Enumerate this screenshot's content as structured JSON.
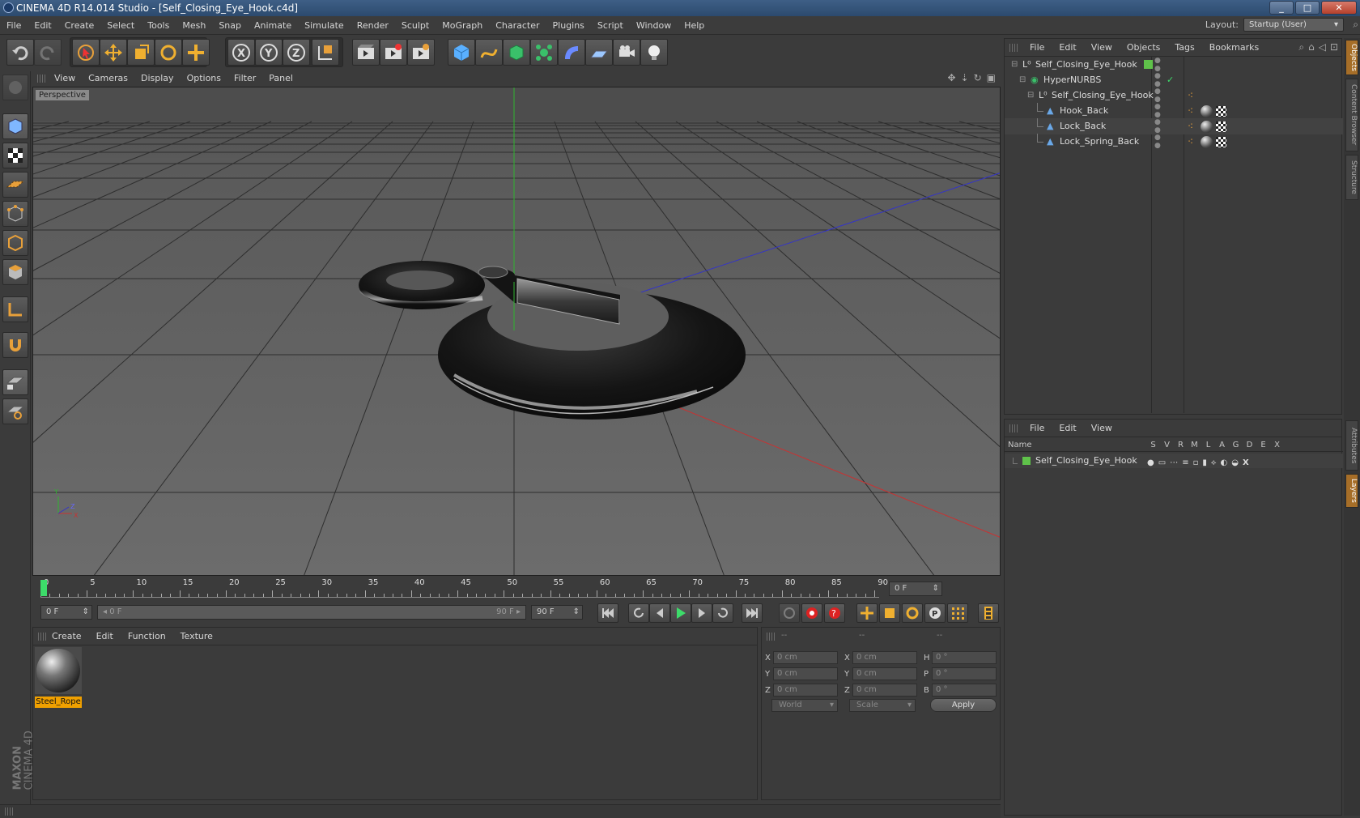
{
  "window": {
    "title": "CINEMA 4D R14.014 Studio - [Self_Closing_Eye_Hook.c4d]",
    "controls": [
      "_",
      "□",
      "✕"
    ]
  },
  "menubar": {
    "items": [
      "File",
      "Edit",
      "Create",
      "Select",
      "Tools",
      "Mesh",
      "Snap",
      "Animate",
      "Simulate",
      "Render",
      "Sculpt",
      "MoGraph",
      "Character",
      "Plugins",
      "Script",
      "Window",
      "Help"
    ],
    "layout_label": "Layout:",
    "layout_value": "Startup (User)"
  },
  "viewport": {
    "menu": [
      "View",
      "Cameras",
      "Display",
      "Options",
      "Filter",
      "Panel"
    ],
    "label": "Perspective",
    "axis": {
      "y": "Y",
      "z": "Z",
      "x": "X"
    }
  },
  "timeline": {
    "ticks": [
      "0",
      "5",
      "10",
      "15",
      "20",
      "25",
      "30",
      "35",
      "40",
      "45",
      "50",
      "55",
      "60",
      "65",
      "70",
      "75",
      "80",
      "85",
      "90"
    ],
    "current_frame": "0 F",
    "start": "0 F",
    "range_start": "0 F",
    "range_end": "90 F",
    "end": "90 F"
  },
  "materials": {
    "menu": [
      "Create",
      "Edit",
      "Function",
      "Texture"
    ],
    "items": [
      {
        "name": "Steel_Rope"
      }
    ]
  },
  "coords": {
    "headers": [
      "--",
      "--",
      "--"
    ],
    "rows": [
      {
        "a": "X",
        "av": "0 cm",
        "b": "X",
        "bv": "0 cm",
        "c": "H",
        "cv": "0 °"
      },
      {
        "a": "Y",
        "av": "0 cm",
        "b": "Y",
        "bv": "0 cm",
        "c": "P",
        "cv": "0 °"
      },
      {
        "a": "Z",
        "av": "0 cm",
        "b": "Z",
        "bv": "0 cm",
        "c": "B",
        "cv": "0 °"
      }
    ],
    "space": "World",
    "mode": "Scale",
    "apply": "Apply"
  },
  "objects": {
    "menu": [
      "File",
      "Edit",
      "View",
      "Objects",
      "Tags",
      "Bookmarks"
    ],
    "tree": [
      {
        "name": "Self_Closing_Eye_Hook",
        "icon": "null-icon"
      },
      {
        "name": "HyperNURBS",
        "icon": "hypernurbs-icon"
      },
      {
        "name": "Self_Closing_Eye_Hook",
        "icon": "null-icon"
      },
      {
        "name": "Hook_Back",
        "icon": "polygon-icon"
      },
      {
        "name": "Lock_Back",
        "icon": "polygon-icon"
      },
      {
        "name": "Lock_Spring_Back",
        "icon": "polygon-icon"
      }
    ]
  },
  "layers": {
    "menu": [
      "File",
      "Edit",
      "View"
    ],
    "columns": {
      "name": "Name",
      "flags": [
        "S",
        "V",
        "R",
        "M",
        "L",
        "A",
        "G",
        "D",
        "E",
        "X"
      ]
    },
    "rows": [
      {
        "name": "Self_Closing_Eye_Hook",
        "color": "#5fc24a"
      }
    ]
  },
  "side_tabs": [
    "Objects",
    "Content Browser",
    "Structure",
    "Attributes",
    "Layers"
  ],
  "branding": {
    "maxon": "MAXON",
    "product": "CINEMA 4D"
  },
  "colors": {
    "accent": "#e8a03a",
    "select": "#f0a000",
    "xaxis": "#c83232",
    "yaxis": "#32c832",
    "zaxis": "#3232c8"
  }
}
